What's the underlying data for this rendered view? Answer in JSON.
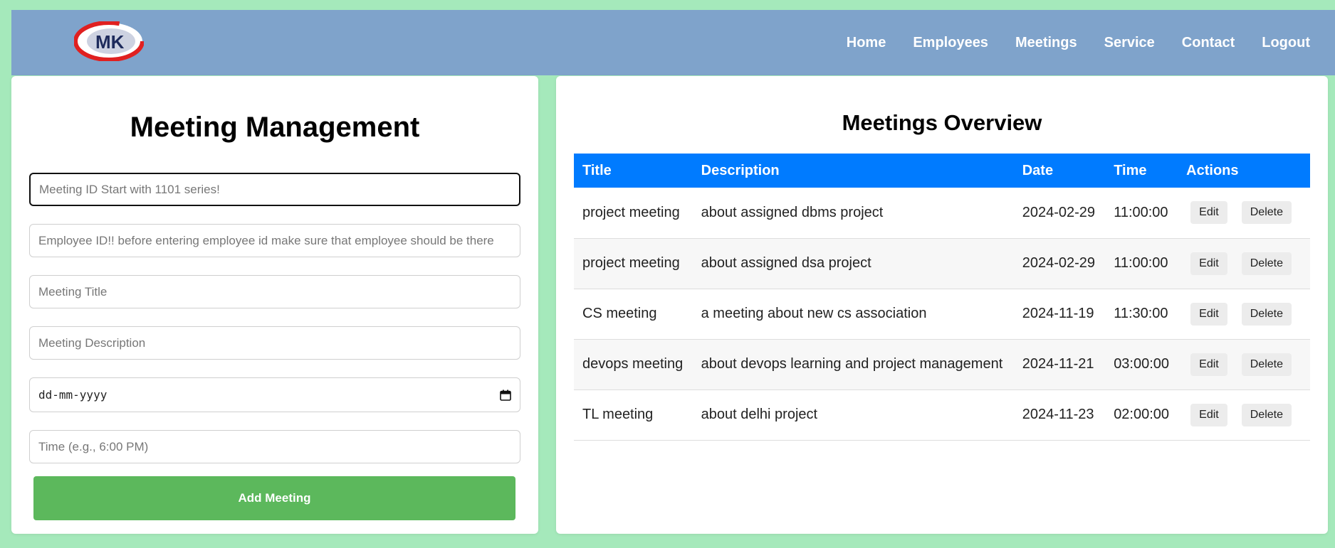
{
  "nav": {
    "logo_text": "MK",
    "links": [
      "Home",
      "Employees",
      "Meetings",
      "Service",
      "Contact",
      "Logout"
    ]
  },
  "form": {
    "title": "Meeting Management",
    "meeting_id_placeholder": "Meeting ID Start with 1101 series!",
    "employee_id_placeholder": "Employee ID!! before entering employee id make sure that employee should be there",
    "meeting_title_placeholder": "Meeting Title",
    "meeting_description_placeholder": "Meeting Description",
    "date_placeholder": "dd-mm-yyyy",
    "time_placeholder": "Time (e.g., 6:00 PM)",
    "submit_label": "Add Meeting"
  },
  "overview": {
    "title": "Meetings Overview",
    "columns": [
      "Title",
      "Description",
      "Date",
      "Time",
      "Actions"
    ],
    "rows": [
      {
        "title": "project meeting",
        "description": "about assigned dbms project",
        "date": "2024-02-29",
        "time": "11:00:00"
      },
      {
        "title": "project meeting",
        "description": "about assigned dsa project",
        "date": "2024-02-29",
        "time": "11:00:00"
      },
      {
        "title": "CS meeting",
        "description": "a meeting about new cs association",
        "date": "2024-11-19",
        "time": "11:30:00"
      },
      {
        "title": "devops meeting",
        "description": "about devops learning and project management",
        "date": "2024-11-21",
        "time": "03:00:00"
      },
      {
        "title": "TL meeting",
        "description": "about delhi project",
        "date": "2024-11-23",
        "time": "02:00:00"
      }
    ],
    "edit_label": "Edit",
    "delete_label": "Delete"
  },
  "colors": {
    "page_background": "#a5e9bb",
    "navbar": "#7fa3cb",
    "table_header": "#007bff",
    "submit_button": "#5cb85c"
  }
}
